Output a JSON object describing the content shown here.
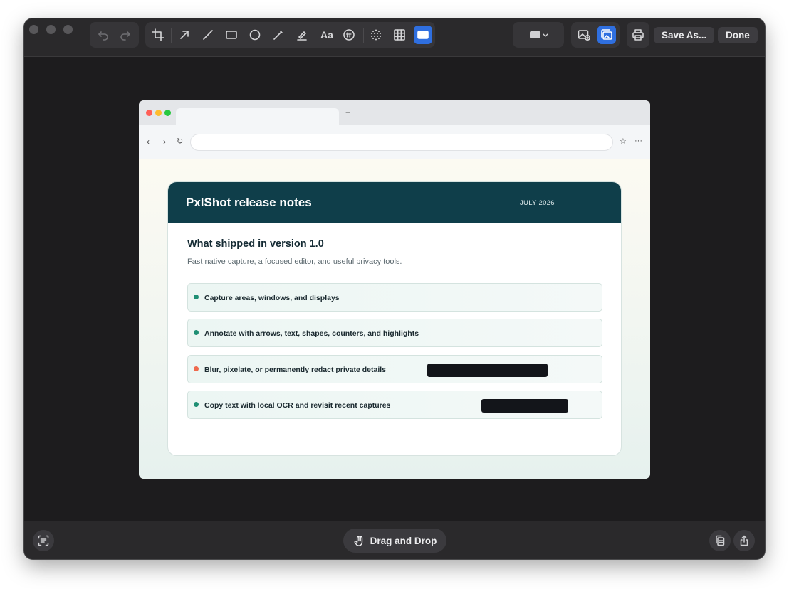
{
  "toolbar": {
    "save_as_label": "Save As...",
    "done_label": "Done",
    "text_tool_label": "Aa",
    "accent_color": "#2f6fe0",
    "icons": [
      "undo-icon",
      "redo-icon",
      "crop-icon",
      "arrow-icon",
      "line-icon",
      "rectangle-icon",
      "ellipse-icon",
      "pen-icon",
      "highlighter-icon",
      "text-icon",
      "counter-icon",
      "blur-icon",
      "pixelate-icon",
      "redact-icon",
      "color-swatch-icon",
      "background-icon",
      "copy-frame-icon",
      "print-icon"
    ]
  },
  "content": {
    "title": "PxlShot release notes",
    "date": "JULY 2026",
    "heading": "What shipped in version 1.0",
    "subtitle": "Fast native capture, a focused editor, and useful privacy tools.",
    "features": [
      {
        "text": "Capture areas, windows, and displays",
        "bullet_color": "#1f8f74",
        "redacted": false
      },
      {
        "text": "Annotate with arrows, text, shapes, counters, and highlights",
        "bullet_color": "#1f8f74",
        "redacted": false
      },
      {
        "text": "Blur, pixelate, or permanently redact private details",
        "bullet_color": "#ef6a4e",
        "redacted": true
      },
      {
        "text": "Copy text with local OCR and revisit recent captures",
        "bullet_color": "#1f8f74",
        "redacted": true
      }
    ],
    "header_color": "#0f3e4a"
  },
  "bottom": {
    "drag_label": "Drag and Drop"
  }
}
